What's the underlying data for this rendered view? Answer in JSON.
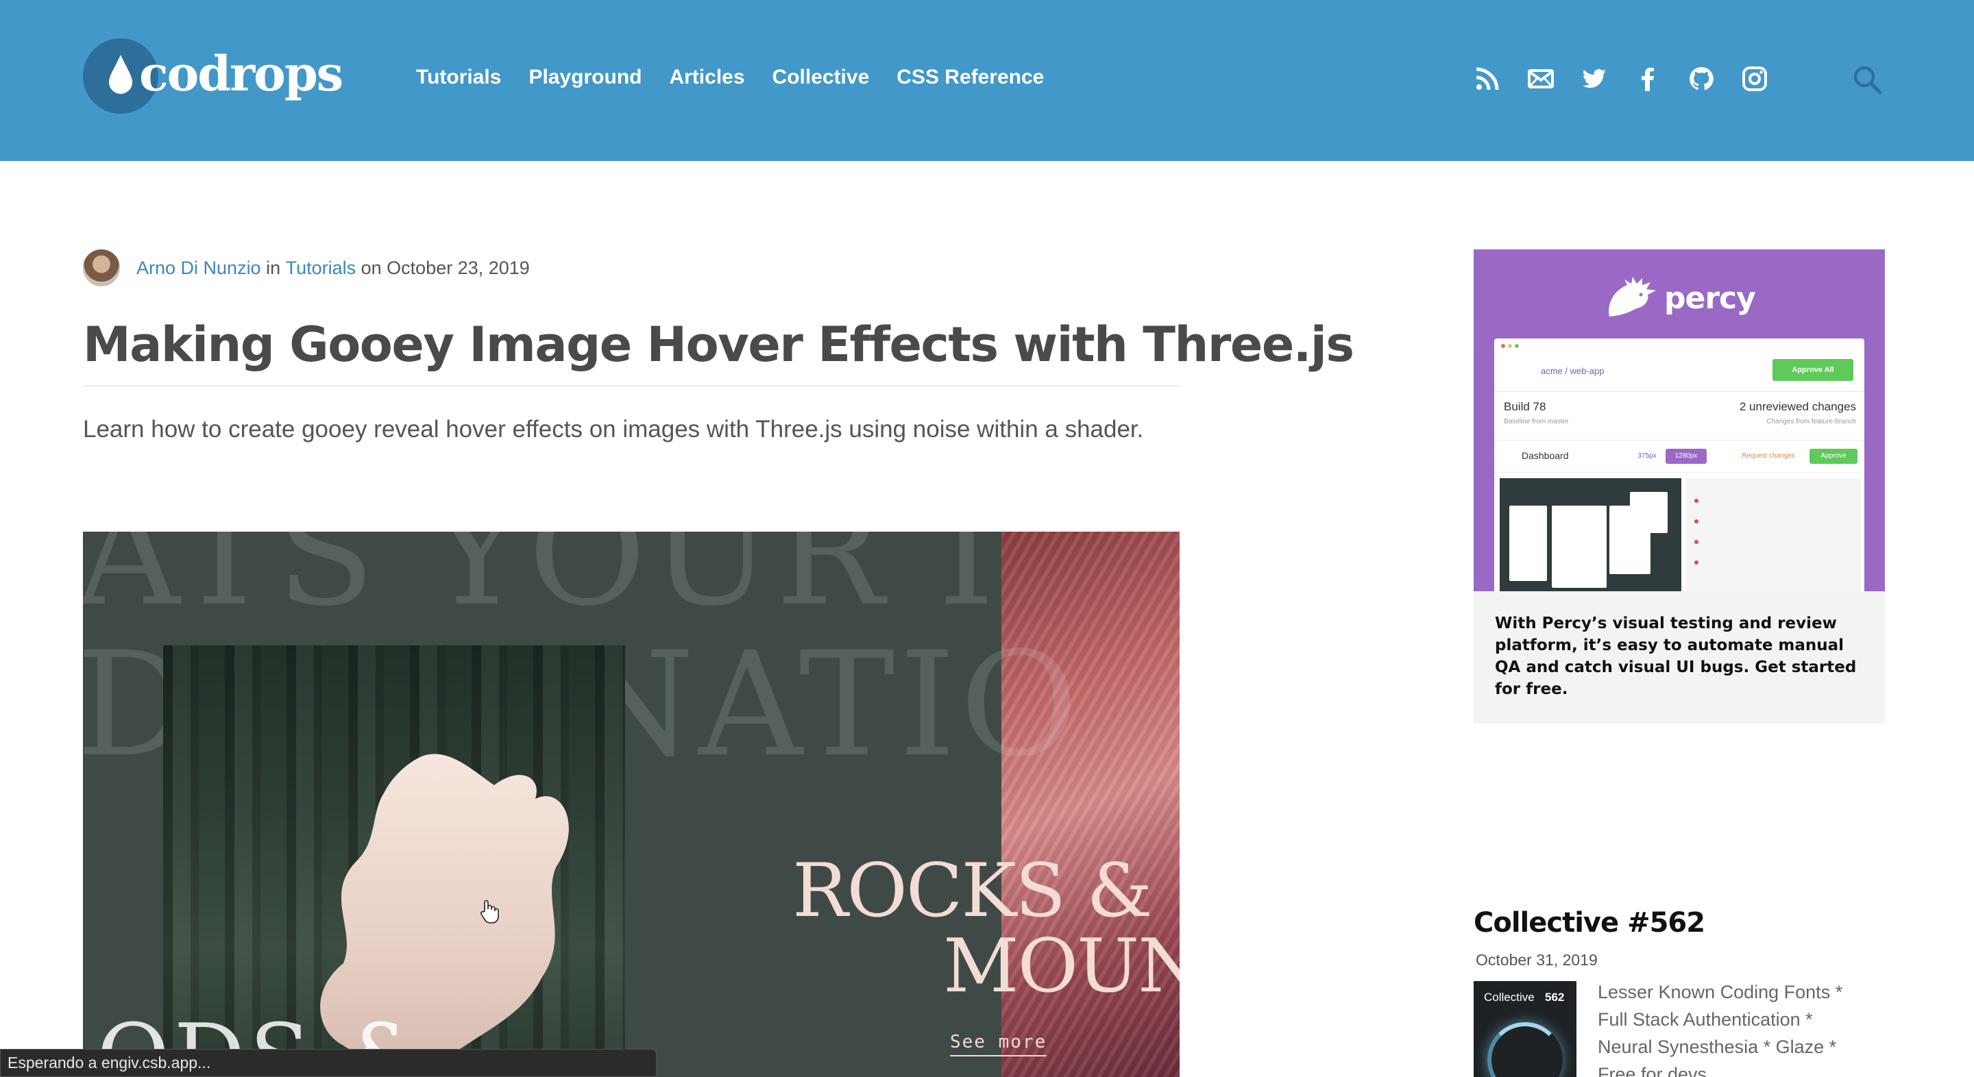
{
  "header": {
    "logo_text": "codrops",
    "nav": [
      "Tutorials",
      "Playground",
      "Articles",
      "Collective",
      "CSS Reference"
    ],
    "social_icons": [
      "rss-icon",
      "mail-icon",
      "twitter-icon",
      "facebook-icon",
      "github-icon",
      "instagram-icon"
    ],
    "search_icon": "search-icon",
    "bg_color": "#4298c9"
  },
  "article": {
    "author": "Arno Di Nunzio",
    "in_text": " in ",
    "category": "Tutorials",
    "on_text": " on October 23, 2019",
    "title": "Making Gooey Image Hover Effects with Three.js",
    "lede": "Learn how to create gooey reveal hover effects on images with Three.js using noise within a shader.",
    "hero": {
      "bg_text_1": "ATS YOUR I",
      "bg_text_2": "DESTINATIO",
      "rocks_line_1": "ROCKS &",
      "rocks_line_2": "MOUN",
      "bottom_text": "ODS &",
      "see_more": "See more"
    }
  },
  "ad": {
    "brand": "percy",
    "screenshot": {
      "repo": "acme / web-app",
      "approve_all": "Approve All",
      "build": "Build 78",
      "baseline": "Baseline from  master",
      "unreviewed": "2 unreviewed changes",
      "changes_from": "Changes from  feature-branch",
      "dashboard": "Dashboard",
      "w1": "375px",
      "w2": "1280px",
      "request": "Request changes",
      "approve": "Approve"
    },
    "text": "With Percy’s visual testing and review platform, it’s easy to automate manual QA and catch visual UI bugs. Get started for free.",
    "accent": "#9a69c5"
  },
  "collective": {
    "title": "Collective #562",
    "date": "October 31, 2019",
    "thumb_label": "Collective",
    "thumb_num": "562",
    "links": [
      "Lesser Known Coding Fonts *",
      "Full Stack Authentication *",
      "Neural Synesthesia * Glaze *",
      "Free for devs"
    ]
  },
  "status": {
    "text": "Esperando a engiv.csb.app..."
  }
}
